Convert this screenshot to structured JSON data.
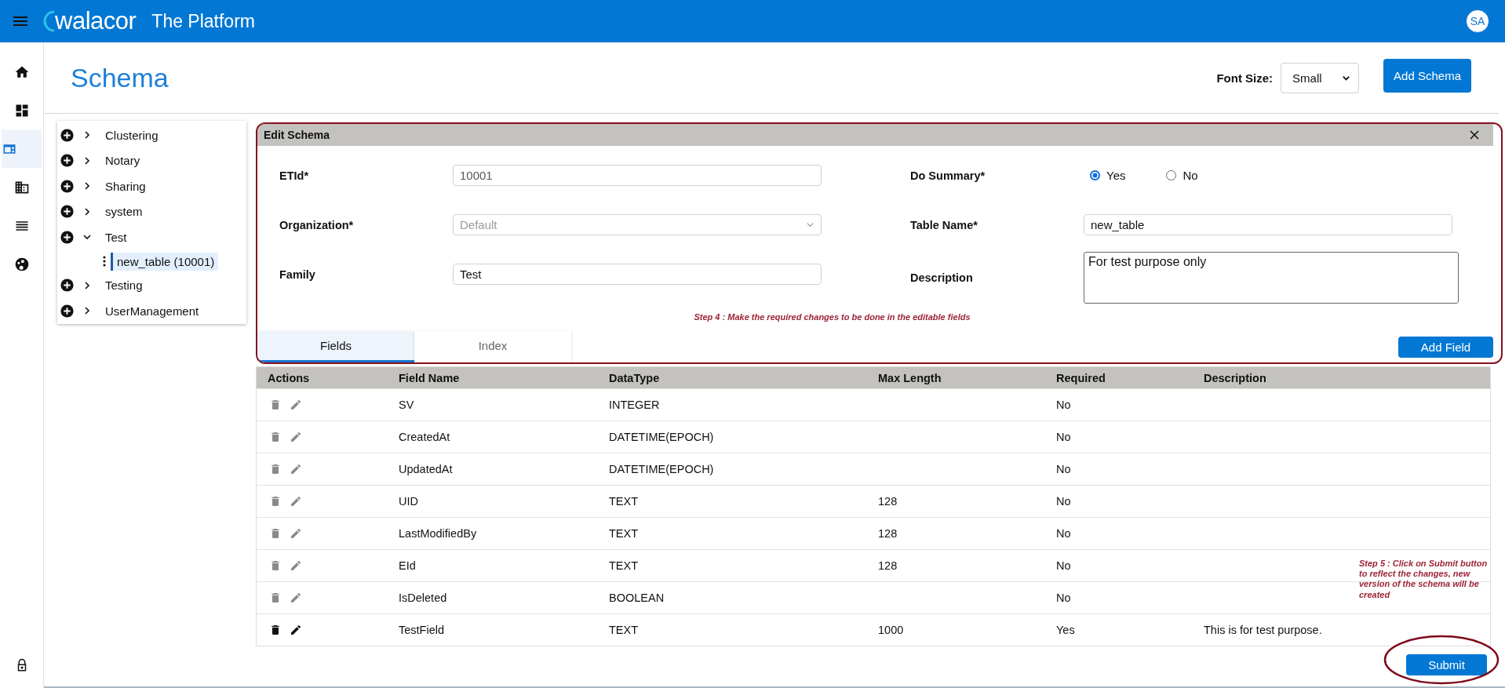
{
  "app_bar": {
    "logo": "walacor",
    "title": "The Platform",
    "avatar": "SA"
  },
  "sidebar": {
    "items": [
      {
        "selected": false
      },
      {
        "selected": false
      },
      {
        "selected": true
      },
      {
        "selected": false
      },
      {
        "selected": false
      },
      {
        "selected": false
      }
    ]
  },
  "page": {
    "title": "Schema",
    "font_size_label": "Font Size:",
    "font_size": "Small",
    "add_button": "Add Schema"
  },
  "tree": [
    {
      "label": "Clustering",
      "expanded": false,
      "selected": false
    },
    {
      "label": "Notary",
      "expanded": false,
      "selected": false
    },
    {
      "label": "Sharing",
      "expanded": false,
      "selected": false
    },
    {
      "label": "system",
      "expanded": false,
      "selected": false
    },
    {
      "label": "Test",
      "expanded": true,
      "selected": false,
      "children": [
        {
          "label": "new_table (10001)",
          "selected": true
        }
      ]
    },
    {
      "label": "Testing",
      "expanded": false,
      "selected": false
    },
    {
      "label": "UserManagement",
      "expanded": false,
      "selected": false
    }
  ],
  "edit_schema": {
    "title": "Edit Schema",
    "etid": {
      "label": "ETId*",
      "value": "10001"
    },
    "organization": {
      "label": "Organization*",
      "value": "Default",
      "disabled": true
    },
    "family": {
      "label": "Family",
      "value": "Test"
    },
    "do_summary": {
      "label": "Do Summary*",
      "options": [
        {
          "label": "Yes",
          "selected": true
        },
        {
          "label": "No",
          "selected": false
        }
      ]
    },
    "table_name": {
      "label": "Table Name*",
      "value": "new_table"
    },
    "description": {
      "label": "Description",
      "value": "For test purpose only"
    },
    "note": "Step 4 : Make the required changes to be done in the editable fields",
    "tabs": [
      {
        "label": "Fields",
        "selected": true
      },
      {
        "label": "Index",
        "selected": false
      }
    ],
    "add_field": "Add Field"
  },
  "table": {
    "columns": [
      "Actions",
      "Field Name",
      "DataType",
      "Max Length",
      "Required",
      "Description"
    ],
    "rows": [
      {
        "editable": false,
        "field_name": "SV",
        "data_type": "INTEGER",
        "max_length": "",
        "required": "No",
        "description": ""
      },
      {
        "editable": false,
        "field_name": "CreatedAt",
        "data_type": "DATETIME(EPOCH)",
        "max_length": "",
        "required": "No",
        "description": ""
      },
      {
        "editable": false,
        "field_name": "UpdatedAt",
        "data_type": "DATETIME(EPOCH)",
        "max_length": "",
        "required": "No",
        "description": ""
      },
      {
        "editable": false,
        "field_name": "UID",
        "data_type": "TEXT",
        "max_length": "128",
        "required": "No",
        "description": ""
      },
      {
        "editable": false,
        "field_name": "LastModifiedBy",
        "data_type": "TEXT",
        "max_length": "128",
        "required": "No",
        "description": ""
      },
      {
        "editable": false,
        "field_name": "EId",
        "data_type": "TEXT",
        "max_length": "128",
        "required": "No",
        "description": ""
      },
      {
        "editable": false,
        "field_name": "IsDeleted",
        "data_type": "BOOLEAN",
        "max_length": "",
        "required": "No",
        "description": ""
      },
      {
        "editable": true,
        "field_name": "TestField",
        "data_type": "TEXT",
        "max_length": "1000",
        "required": "Yes",
        "description": "This is for test purpose."
      }
    ]
  },
  "submit_note": "Step 5 : Click on Submit button to reflect the changes, new version of the schema will be created",
  "submit": "Submit"
}
